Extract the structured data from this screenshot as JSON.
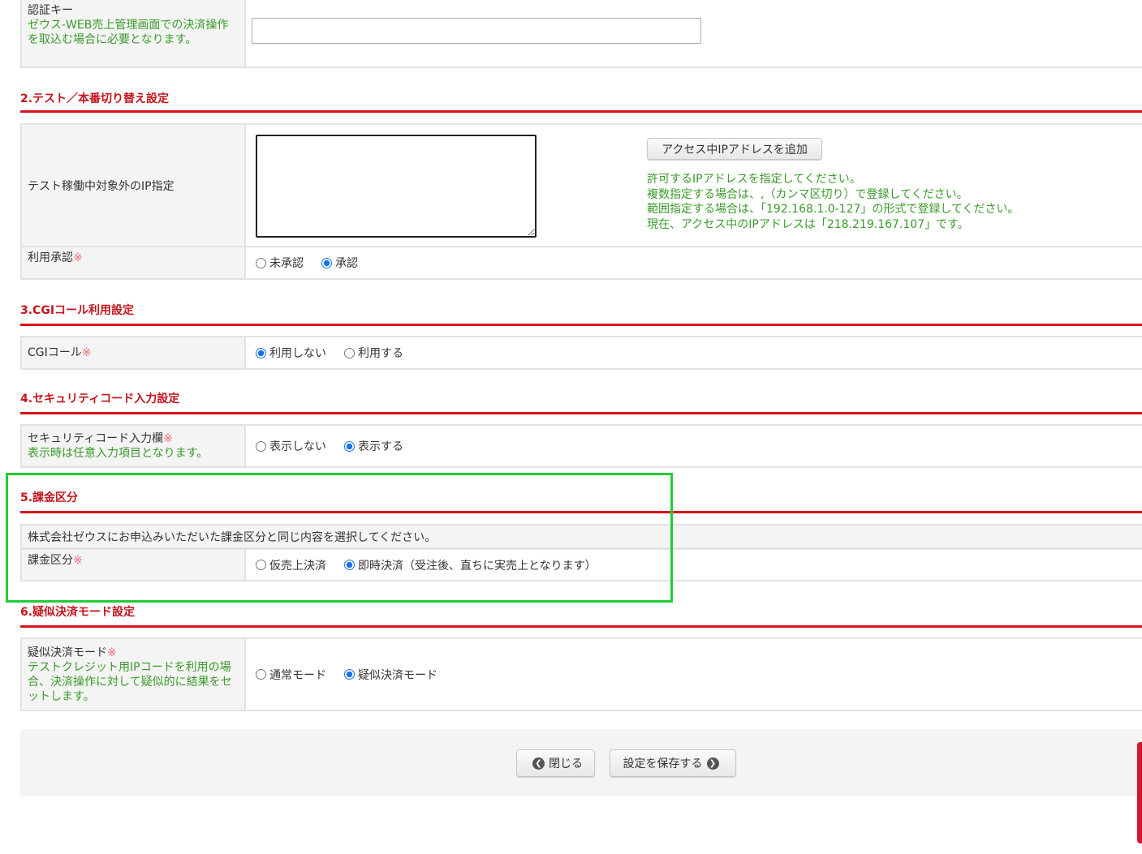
{
  "auth": {
    "label": "認証キー",
    "note": "ゼウス-WEB売上管理画面での決済操作を取込む場合に必要となります。",
    "value": ""
  },
  "sec2": {
    "title": "2.テスト／本番切り替え設定",
    "ip_label": "テスト稼働中対象外のIP指定",
    "ip_value": "",
    "add_button": "アクセス中IPアドレスを追加",
    "help": [
      "許可するIPアドレスを指定してください。",
      "複数指定する場合は、,（カンマ区切り）で登録してください。",
      "範囲指定する場合は、「192.168.1.0-127」の形式で登録してください。",
      "現在、アクセス中のIPアドレスは「218.219.167.107」です。"
    ],
    "approval_label": "利用承認",
    "approval_options": [
      "未承認",
      "承認"
    ],
    "approval_selected": "承認"
  },
  "required_mark": "※",
  "sec3": {
    "title": "3.CGIコール利用設定",
    "label": "CGIコール",
    "options": [
      "利用しない",
      "利用する"
    ],
    "selected": "利用しない"
  },
  "sec4": {
    "title": "4.セキュリティコード入力設定",
    "label": "セキュリティコード入力欄",
    "note": "表示時は任意入力項目となります。",
    "options": [
      "表示しない",
      "表示する"
    ],
    "selected": "表示する"
  },
  "sec5": {
    "title": "5.課金区分",
    "info": "株式会社ゼウスにお申込みいただいた課金区分と同じ内容を選択してください。",
    "label": "課金区分",
    "options": [
      "仮売上決済",
      "即時決済（受注後、直ちに実売上となります）"
    ],
    "selected": "即時決済（受注後、直ちに実売上となります）"
  },
  "sec6": {
    "title": "6.疑似決済モード設定",
    "label": "疑似決済モード",
    "note": "テストクレジット用IPコードを利用の場合、決済操作に対して疑似的に結果をセットします。",
    "options": [
      "通常モード",
      "疑似決済モード"
    ],
    "selected": "疑似決済モード"
  },
  "footer": {
    "close": "閉じる",
    "save": "設定を保存する"
  },
  "colors": {
    "highlight": "#22cc33",
    "section": "#c4141c",
    "note": "#3a9a2a"
  }
}
